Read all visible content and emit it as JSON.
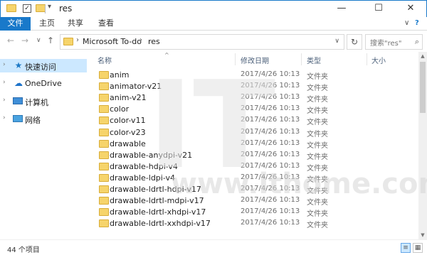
{
  "window": {
    "title": "res",
    "minimize_glyph": "—",
    "maximize_glyph": "☐",
    "close_glyph": "✕"
  },
  "quick_access_toolbar": {
    "dropdown_glyph": "▾"
  },
  "ribbon": {
    "tabs": [
      {
        "label": "文件"
      },
      {
        "label": "主页"
      },
      {
        "label": "共享"
      },
      {
        "label": "查看"
      }
    ],
    "expand_glyph": "∨",
    "help_glyph": "?"
  },
  "address": {
    "back_glyph": "←",
    "forward_glyph": "→",
    "recent_glyph": "∨",
    "up_glyph": "↑",
    "crumb_sep": "›",
    "crumbs": [
      {
        "label": "Microsoft To-do"
      },
      {
        "label": "res"
      }
    ],
    "history_glyph": "∨",
    "refresh_glyph": "↻",
    "search_placeholder": "搜索\"res\"",
    "search_glyph": "⌕"
  },
  "nav_pane": {
    "expand_glyph": "›",
    "items": [
      {
        "label": "快速访问",
        "icon": "star-icon",
        "glyph": "★",
        "selected": true
      },
      {
        "label": "OneDrive",
        "icon": "cloud-icon",
        "glyph": "☁",
        "selected": false
      },
      {
        "label": "计算机",
        "icon": "computer-icon",
        "glyph": "",
        "selected": false
      },
      {
        "label": "网络",
        "icon": "network-icon",
        "glyph": "",
        "selected": false
      }
    ]
  },
  "file_list": {
    "sort_glyph": "^",
    "columns": {
      "name": "名称",
      "date": "修改日期",
      "type": "类型",
      "size": "大小"
    },
    "rows": [
      {
        "name": "anim",
        "date": "2017/4/26 10:13",
        "type": "文件夹"
      },
      {
        "name": "animator-v21",
        "date": "2017/4/26 10:13",
        "type": "文件夹"
      },
      {
        "name": "anim-v21",
        "date": "2017/4/26 10:13",
        "type": "文件夹"
      },
      {
        "name": "color",
        "date": "2017/4/26 10:13",
        "type": "文件夹"
      },
      {
        "name": "color-v11",
        "date": "2017/4/26 10:13",
        "type": "文件夹"
      },
      {
        "name": "color-v23",
        "date": "2017/4/26 10:13",
        "type": "文件夹"
      },
      {
        "name": "drawable",
        "date": "2017/4/26 10:13",
        "type": "文件夹"
      },
      {
        "name": "drawable-anydpi-v21",
        "date": "2017/4/26 10:13",
        "type": "文件夹"
      },
      {
        "name": "drawable-hdpi-v4",
        "date": "2017/4/26 10:13",
        "type": "文件夹"
      },
      {
        "name": "drawable-ldpi-v4",
        "date": "2017/4/26 10:13",
        "type": "文件夹"
      },
      {
        "name": "drawable-ldrtl-hdpi-v17",
        "date": "2017/4/26 10:13",
        "type": "文件夹"
      },
      {
        "name": "drawable-ldrtl-mdpi-v17",
        "date": "2017/4/26 10:13",
        "type": "文件夹"
      },
      {
        "name": "drawable-ldrtl-xhdpi-v17",
        "date": "2017/4/26 10:13",
        "type": "文件夹"
      },
      {
        "name": "drawable-ldrtl-xxhdpi-v17",
        "date": "2017/4/26 10:13",
        "type": "文件夹"
      }
    ]
  },
  "scrollbar": {
    "up_glyph": "▲",
    "down_glyph": "▼"
  },
  "status": {
    "item_count": "44 个项目",
    "details_view_glyph": "≡",
    "large_icons_glyph": "▦"
  },
  "watermark": {
    "logo_text": "IT",
    "url": "www.ithome.com"
  },
  "colors": {
    "accent": "#1979ca",
    "selection": "#cce8ff",
    "folder": "#f6d46b",
    "watermark": "#dcdcdc"
  }
}
